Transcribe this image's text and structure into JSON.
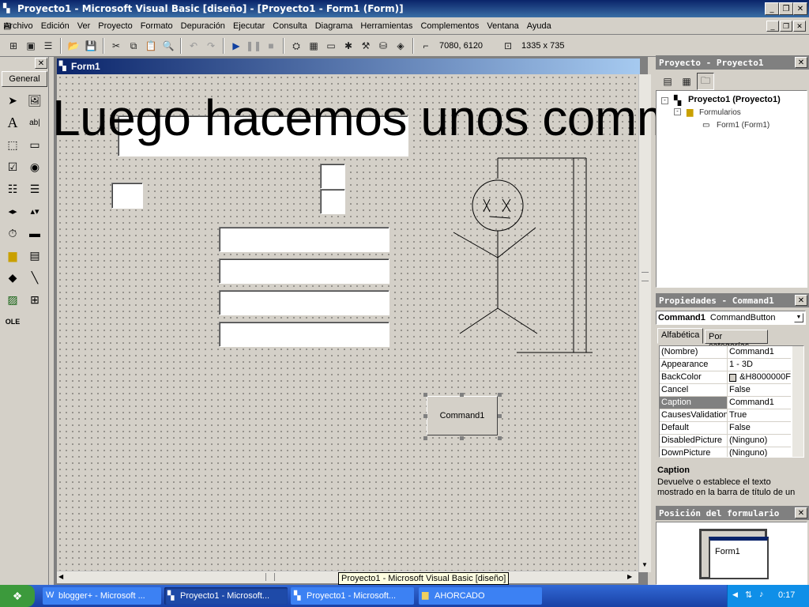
{
  "window": {
    "title": "Proyecto1 - Microsoft Visual Basic [diseño] - [Proyecto1 - Form1 (Form)]"
  },
  "menu": [
    "Archivo",
    "Edición",
    "Ver",
    "Proyecto",
    "Formato",
    "Depuración",
    "Ejecutar",
    "Consulta",
    "Diagrama",
    "Herramientas",
    "Complementos",
    "Ventana",
    "Ayuda"
  ],
  "toolbar": {
    "position": "7080, 6120",
    "size": "1335 x 735"
  },
  "toolbox": {
    "tab": "General"
  },
  "form": {
    "title": "Form1",
    "command_caption": "Command1"
  },
  "overlay_text": "Luego hacemos unos command",
  "project": {
    "title": "Proyecto - Proyecto1",
    "root": "Proyecto1 (Proyecto1)",
    "folder": "Formularios",
    "form": "Form1 (Form1)"
  },
  "properties": {
    "title": "Propiedades - Command1",
    "object_name": "Command1",
    "object_type": "CommandButton",
    "tab_alpha": "Alfabética",
    "tab_cat": "Por categorías",
    "rows": [
      {
        "name": "(Nombre)",
        "value": "Command1"
      },
      {
        "name": "Appearance",
        "value": "1 - 3D"
      },
      {
        "name": "BackColor",
        "value": "&H8000000F"
      },
      {
        "name": "Cancel",
        "value": "False"
      },
      {
        "name": "Caption",
        "value": "Command1"
      },
      {
        "name": "CausesValidation",
        "value": "True"
      },
      {
        "name": "Default",
        "value": "False"
      },
      {
        "name": "DisabledPicture",
        "value": "(Ninguno)"
      },
      {
        "name": "DownPicture",
        "value": "(Ninguno)"
      }
    ],
    "desc_title": "Caption",
    "desc_text": "Devuelve o establece el texto mostrado en la barra de título de un"
  },
  "layout_panel": {
    "title": "Posición del formulario",
    "form_label": "Form1"
  },
  "tooltip": "Proyecto1 - Microsoft Visual Basic [diseño]",
  "taskbar": {
    "tasks": [
      "blogger+ - Microsoft ...",
      "Proyecto1 - Microsoft...",
      "Proyecto1 - Microsoft...",
      "AHORCADO"
    ],
    "clock": "0:17"
  },
  "colors": {
    "titlebar": "#0a246a",
    "face": "#d4d0c8",
    "taskbar": "#245edb",
    "start": "#3c9a3c"
  }
}
